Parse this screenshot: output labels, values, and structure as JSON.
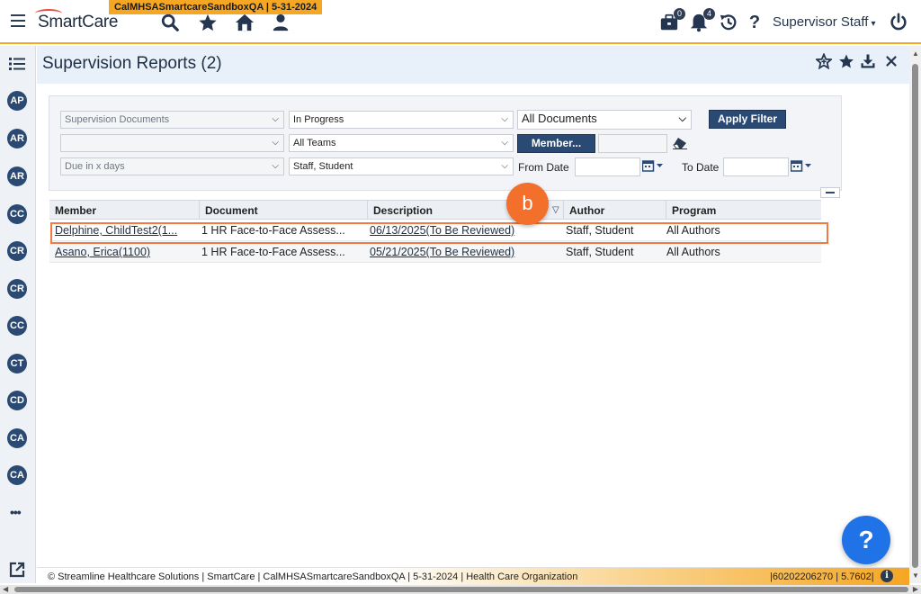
{
  "env_badge": "CalMHSASmartcareSandboxQA | 5-31-2024",
  "app": {
    "logo": "SmartCare"
  },
  "topbar": {
    "icons": [
      "search-icon",
      "star-icon",
      "home-icon",
      "person-icon",
      "briefcase-icon",
      "bell-icon",
      "history-icon",
      "help-icon",
      "power-icon"
    ],
    "briefcase_count": "0",
    "bell_count": "4",
    "help_label": "?",
    "user_name": "Supervisor Staff",
    "user_caret": "▾"
  },
  "sidebar": {
    "avatars": [
      "AP",
      "AR",
      "AR",
      "CC",
      "CR",
      "CR",
      "CC",
      "CT",
      "CD",
      "CA",
      "CA"
    ],
    "more_label": "•••"
  },
  "page": {
    "title": "Supervision Reports (2)"
  },
  "filters": {
    "document_type": "Supervision Documents",
    "status": "In Progress",
    "documents": "All Documents",
    "apply_label": "Apply Filter",
    "blank_select": "",
    "teams": "All Teams",
    "member_label": "Member...",
    "due": "Due in x days",
    "staff_student": "Staff, Student",
    "from_label": "From Date",
    "to_label": "To Date",
    "from_value": "",
    "to_value": ""
  },
  "grid": {
    "columns": [
      "Member",
      "Document",
      "Description",
      "Author",
      "Program"
    ],
    "rows": [
      {
        "member": "Delphine, ChildTest2(1...",
        "document": "1 HR Face-to-Face Assess...",
        "description": "06/13/2025(To Be Reviewed)",
        "author": "Staff, Student",
        "program": "All Authors"
      },
      {
        "member": "Asano, Erica(1100)",
        "document": "1 HR Face-to-Face Assess...",
        "description": "05/21/2025(To Be Reviewed)",
        "author": "Staff, Student",
        "program": "All Authors"
      }
    ]
  },
  "callout_label": "b",
  "help_fab_label": "?",
  "footer": {
    "text": "© Streamline Healthcare Solutions | SmartCare | CalMHSASmartcareSandboxQA | 5-31-2024 | Health Care Organization",
    "version": "|60202206270 | 5.7602|",
    "info_label": "i"
  },
  "colors": {
    "accent": "#f5a623",
    "navy": "#2b4a73",
    "callout": "#f26f2c",
    "fab": "#1f73e6"
  }
}
